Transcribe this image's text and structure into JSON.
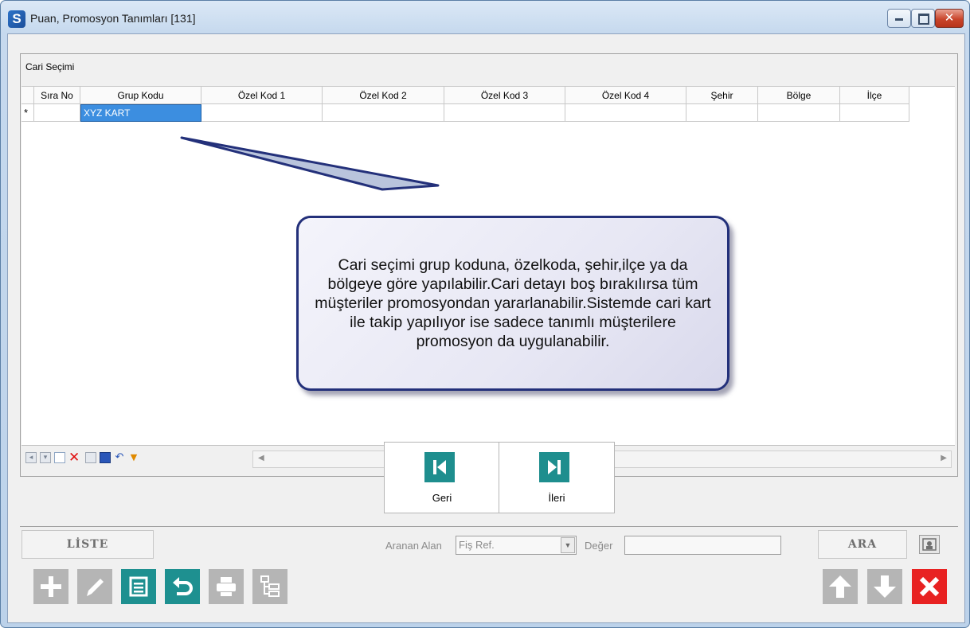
{
  "window": {
    "title": "Puan, Promosyon Tanımları [131]",
    "app_icon": "S"
  },
  "group": {
    "title": "Cari Seçimi"
  },
  "grid": {
    "columns": [
      "Sıra No",
      "Grup Kodu",
      "Özel Kod 1",
      "Özel Kod 2",
      "Özel Kod 3",
      "Özel Kod 4",
      "Şehir",
      "Bölge",
      "İlçe"
    ],
    "new_row_marker": "*",
    "row": {
      "sira_no": "",
      "grup_kodu": "XYZ KART",
      "ozel_kod_1": "",
      "ozel_kod_2": "",
      "ozel_kod_3": "",
      "ozel_kod_4": "",
      "sehir": "",
      "bolge": "",
      "ilce": ""
    }
  },
  "callout": {
    "text": "Cari seçimi grup koduna, özelkoda, şehir,ilçe ya da bölgeye göre yapılabilir.Cari detayı boş bırakılırsa tüm müşteriler promosyondan yararlanabilir.Sistemde cari kart ile takip yapılıyor ise sadece tanımlı müşterilere promosyon da uygulanabilir."
  },
  "nav": {
    "prev_label": "Geri",
    "next_label": "İleri"
  },
  "search": {
    "list_label": "LİSTE",
    "field_label": "Aranan Alan",
    "field_value": "Fiş Ref.",
    "value_label": "Değer",
    "value_input": "",
    "search_label": "ARA"
  },
  "colors": {
    "accent_teal": "#1e9090",
    "disabled_gray": "#b5b5b5",
    "close_red": "#e82222",
    "selected_cell": "#3c8ee0"
  }
}
